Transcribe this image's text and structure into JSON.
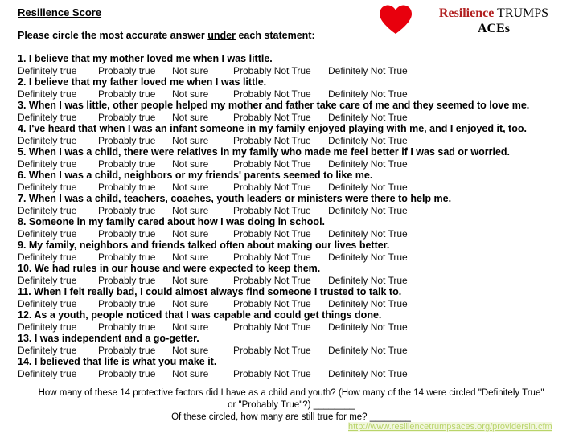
{
  "header": {
    "title": "Resilience Score",
    "instruction_before": "Please circle the most accurate answer ",
    "instruction_underlined": "under",
    "instruction_after": " each statement:"
  },
  "logo": {
    "heart_icon": "heart-icon",
    "word_brand": "Resilience",
    "word_trumps": "TRUMPS",
    "word_aces": "ACEs",
    "brand_color": "#B22222",
    "heart_color": "#E8000D"
  },
  "options": [
    "Definitely true",
    "Probably true",
    "Not sure",
    "Probably Not True",
    "Definitely Not True"
  ],
  "questions": [
    "1. I believe that my mother loved me when I was little.",
    "2. I believe that my father loved me when I was little.",
    "3. When I was little, other people helped my mother and father take care of me and they seemed to love me.",
    "4. I've heard that when I was an infant someone in my family enjoyed playing with me, and I enjoyed it, too.",
    "5. When I was a child, there were relatives in my family who made me feel better if I was sad or worried.",
    "6. When I was a child, neighbors or my friends' parents seemed to like me.",
    "7. When I was a child, teachers, coaches, youth leaders or ministers were there to help me.",
    "8. Someone in my family cared about how I was doing in school.",
    "9. My family, neighbors and friends talked often about making our lives better.",
    "10. We had rules in our house and were expected to keep them.",
    "11. When I felt really bad, I could almost always find someone I trusted to talk to.",
    "12. As a youth, people noticed that I was capable and could get things done.",
    "13. I was independent and a go-getter.",
    "14. I believed that life is what you make it."
  ],
  "footer": {
    "line1": "How many of these 14 protective factors did I have as a child and youth? (How many of the 14 were circled \"Definitely True\"",
    "line2": "or \"Probably True\"?) ________",
    "line3": "Of these circled, how many are still true for me? ________",
    "link": "http://www.resiliencetrumpsaces.org/providersin.cfm"
  }
}
